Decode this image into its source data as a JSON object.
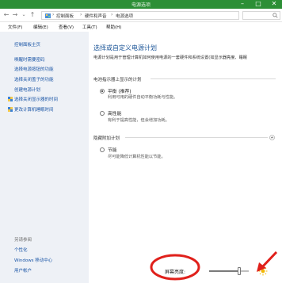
{
  "window": {
    "title": "电源选项",
    "minimize": "–",
    "maximize": "□",
    "close": "✕"
  },
  "address_bar": {
    "back": "←",
    "forward": "→",
    "up": "↑",
    "dropdown": "⌄",
    "crumbs": [
      "控制面板",
      "硬件和声音",
      "电源选项"
    ],
    "separator": "›"
  },
  "menu": {
    "items": [
      "文件(F)",
      "编辑(E)",
      "查看(V)",
      "工具(T)",
      "帮助(H)"
    ]
  },
  "sidebar": {
    "home": "控制面板主页",
    "links": [
      "唤醒时需要密码",
      "选择电源按钮的功能",
      "选择关闭盖子的功能",
      "创建电源计划",
      "选择关闭显示器的时间",
      "更改计算机睡眠时间"
    ],
    "see_also_title": "另请参阅",
    "see_also": [
      "个性化",
      "Windows 移动中心",
      "用户帐户"
    ]
  },
  "main": {
    "heading": "选择或自定义电源计划",
    "description": "电源计划是用于管理计算机如何使用电源的一套硬件和系统设置(如显示器亮度、睡眠",
    "group1_label": "电池指示器上显示的计划",
    "plans": [
      {
        "name": "平衡 (推荐)",
        "desc": "利用可用的硬件自动平衡功耗与性能。",
        "checked": true
      },
      {
        "name": "高性能",
        "desc": "有利于提高性能，但会增加功耗。",
        "checked": false
      }
    ],
    "group2_label": "隐藏附加计划",
    "hidden_plans": [
      {
        "name": "节能",
        "desc": "尽可能降低计算机性能以节能。",
        "checked": false
      }
    ]
  },
  "brightness": {
    "label": "屏幕亮度:",
    "value": 0.75
  }
}
